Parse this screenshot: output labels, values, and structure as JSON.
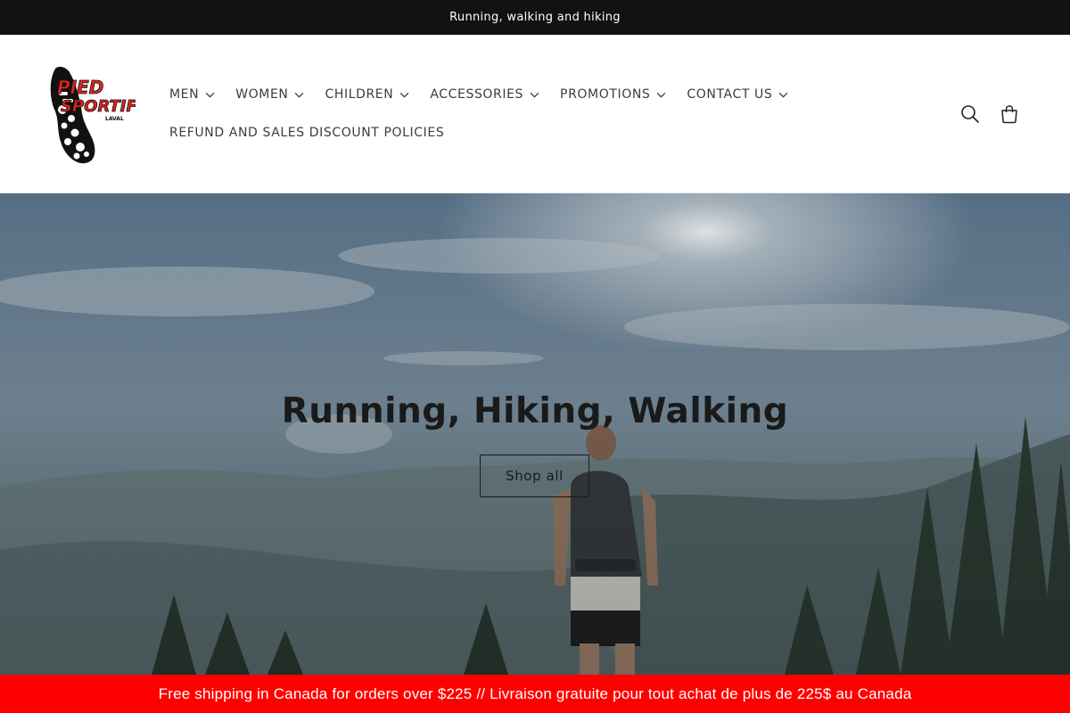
{
  "announcement": {
    "text": "Running, walking and hiking"
  },
  "header": {
    "logo_alt": "Pied Sportif Laval",
    "nav": [
      {
        "label": "MEN",
        "has_dropdown": true
      },
      {
        "label": "WOMEN",
        "has_dropdown": true
      },
      {
        "label": "CHILDREN",
        "has_dropdown": true
      },
      {
        "label": "ACCESSORIES",
        "has_dropdown": true
      },
      {
        "label": "PROMOTIONS",
        "has_dropdown": true
      },
      {
        "label": "CONTACT US",
        "has_dropdown": true
      },
      {
        "label": "REFUND AND SALES DISCOUNT POLICIES",
        "has_dropdown": false
      }
    ],
    "icons": {
      "search": "search-icon",
      "cart": "cart-icon"
    }
  },
  "hero": {
    "title": "Running, Hiking, Walking",
    "button_label": "Shop all"
  },
  "promo_bar": {
    "text": "Free shipping in Canada for orders over $225 // Livraison gratuite pour tout achat de plus de 225$ au Canada",
    "background": "#ff0000"
  },
  "colors": {
    "announcement_bg": "#121212",
    "accent_red": "#e0241b"
  }
}
